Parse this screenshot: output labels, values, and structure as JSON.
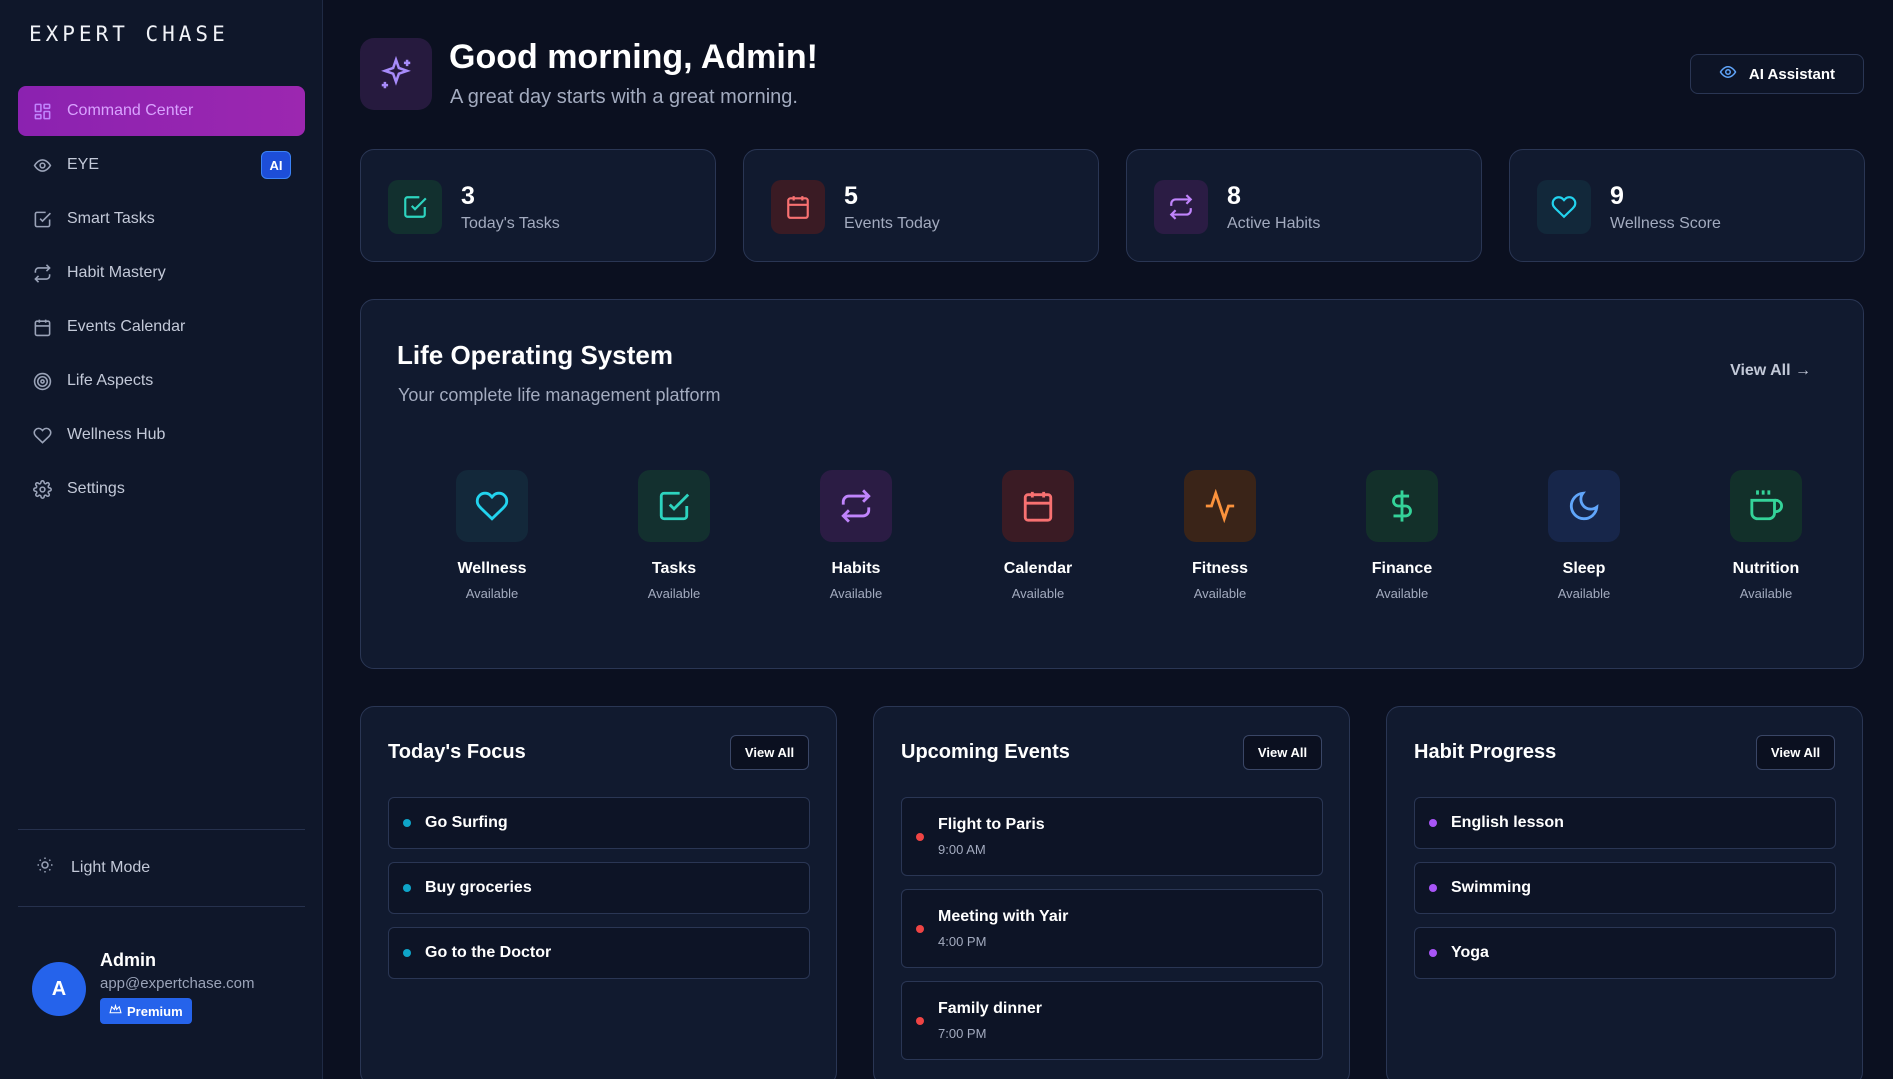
{
  "brand": "EXPERT CHASE",
  "sidebar": {
    "items": [
      {
        "label": "Command Center",
        "icon": "grid-icon"
      },
      {
        "label": "EYE",
        "icon": "eye-icon",
        "badge": "AI"
      },
      {
        "label": "Smart Tasks",
        "icon": "check-square-icon"
      },
      {
        "label": "Habit Mastery",
        "icon": "repeat-icon"
      },
      {
        "label": "Events Calendar",
        "icon": "calendar-icon"
      },
      {
        "label": "Life Aspects",
        "icon": "target-icon"
      },
      {
        "label": "Wellness Hub",
        "icon": "heart-icon"
      },
      {
        "label": "Settings",
        "icon": "gear-icon"
      }
    ],
    "light_mode": "Light Mode",
    "user": {
      "initial": "A",
      "name": "Admin",
      "email": "app@expertchase.com",
      "plan": "Premium"
    }
  },
  "header": {
    "greeting": "Good morning, Admin!",
    "subtitle": "A great day starts with a great morning.",
    "ai_button": "AI Assistant"
  },
  "stats": [
    {
      "value": "3",
      "label": "Today's Tasks",
      "icon": "check-square-icon",
      "color": "#2dd4bf"
    },
    {
      "value": "5",
      "label": "Events Today",
      "icon": "calendar-icon",
      "color": "#f87171"
    },
    {
      "value": "8",
      "label": "Active Habits",
      "icon": "repeat-icon",
      "color": "#c084fc"
    },
    {
      "value": "9",
      "label": "Wellness Score",
      "icon": "heart-icon",
      "color": "#22d3ee"
    }
  ],
  "los": {
    "title": "Life Operating System",
    "subtitle": "Your complete life management platform",
    "view_all": "View All →",
    "apps": [
      {
        "name": "Wellness",
        "status": "Available",
        "icon": "heart-icon"
      },
      {
        "name": "Tasks",
        "status": "Available",
        "icon": "check-square-icon"
      },
      {
        "name": "Habits",
        "status": "Available",
        "icon": "repeat-icon"
      },
      {
        "name": "Calendar",
        "status": "Available",
        "icon": "calendar-icon"
      },
      {
        "name": "Fitness",
        "status": "Available",
        "icon": "activity-icon"
      },
      {
        "name": "Finance",
        "status": "Available",
        "icon": "dollar-icon"
      },
      {
        "name": "Sleep",
        "status": "Available",
        "icon": "moon-icon"
      },
      {
        "name": "Nutrition",
        "status": "Available",
        "icon": "coffee-icon"
      }
    ]
  },
  "focus": {
    "title": "Today's Focus",
    "view_all": "View All",
    "items": [
      "Go Surfing",
      "Buy groceries",
      "Go to the Doctor"
    ]
  },
  "events": {
    "title": "Upcoming Events",
    "view_all": "View All",
    "items": [
      {
        "name": "Flight to Paris",
        "time": "9:00 AM"
      },
      {
        "name": "Meeting with Yair",
        "time": "4:00 PM"
      },
      {
        "name": "Family dinner",
        "time": "7:00 PM"
      }
    ]
  },
  "habits": {
    "title": "Habit Progress",
    "view_all": "View All",
    "items": [
      "English lesson",
      "Swimming",
      "Yoga"
    ]
  }
}
